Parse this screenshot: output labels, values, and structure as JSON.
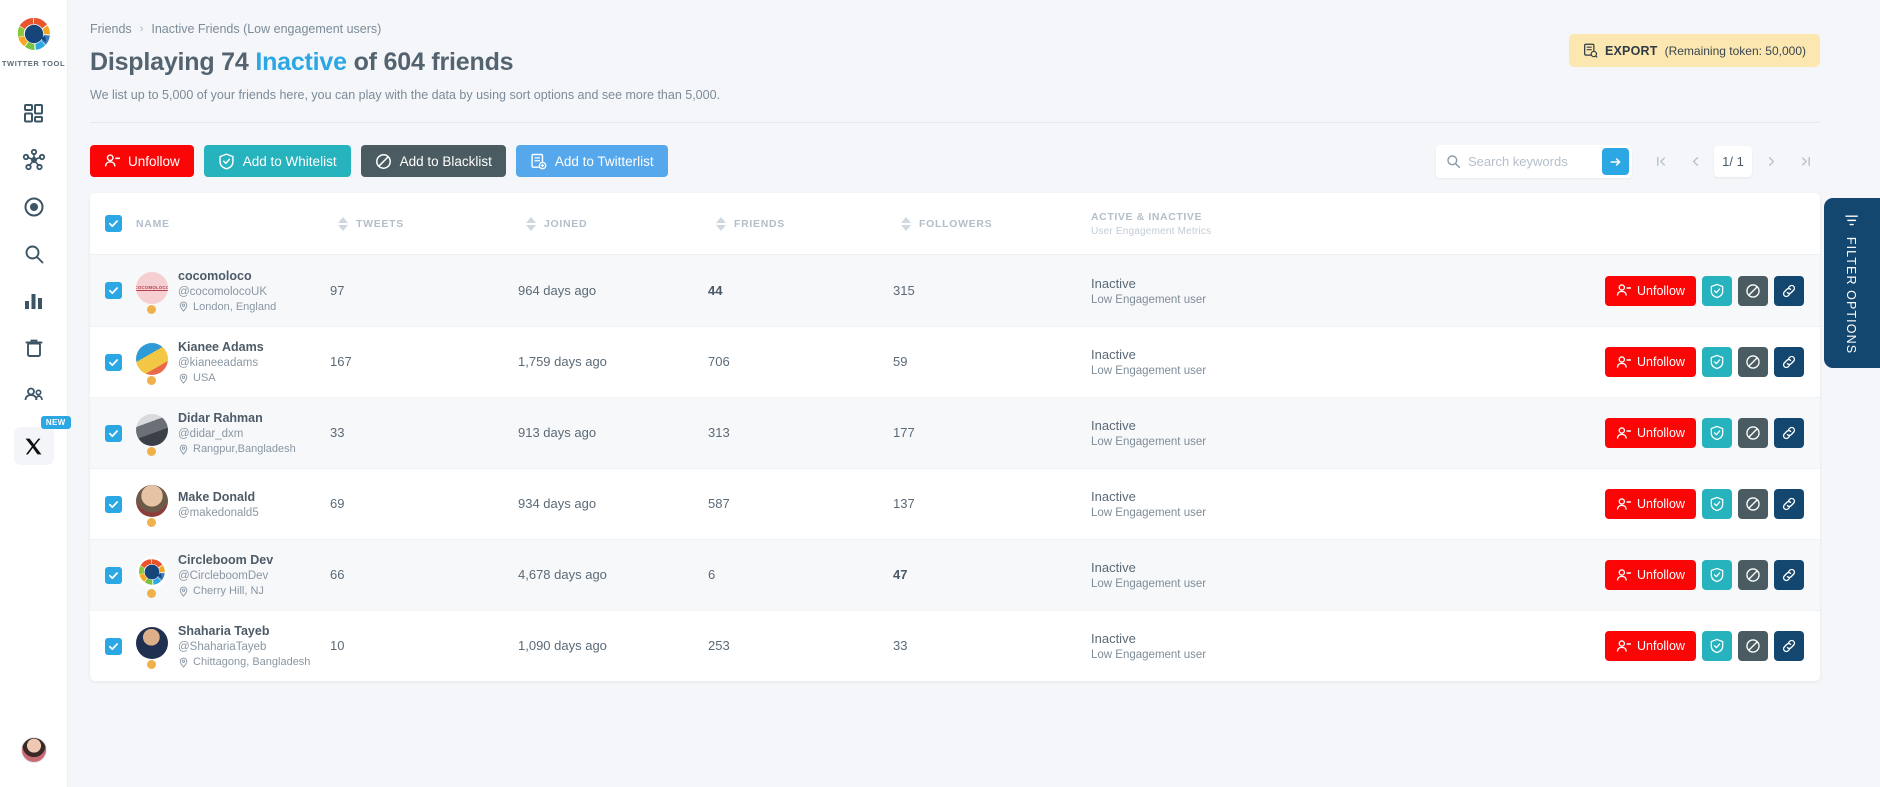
{
  "sidebar": {
    "brand_name": "TWITTER TOOL",
    "items": [
      {
        "name": "dashboard",
        "icon": "dashboard-icon"
      },
      {
        "name": "network",
        "icon": "network-icon"
      },
      {
        "name": "target",
        "icon": "target-icon"
      },
      {
        "name": "search",
        "icon": "search-icon"
      },
      {
        "name": "analytics",
        "icon": "bar-chart-icon"
      },
      {
        "name": "trash",
        "icon": "trash-icon"
      },
      {
        "name": "friends",
        "icon": "users-icon"
      },
      {
        "name": "x-twitter",
        "icon": "x-logo-icon",
        "badge": "NEW"
      }
    ]
  },
  "breadcrumb": {
    "root": "Friends",
    "separator": "›",
    "current": "Inactive Friends (Low engagement users)"
  },
  "header": {
    "title_pre": "Displaying 74 ",
    "title_highlight": "Inactive",
    "title_post": " of 604 friends",
    "subtitle": "We list up to 5,000 of your friends here, you can play with the data by using sort options and see more than 5,000."
  },
  "export": {
    "label": "EXPORT",
    "detail": "(Remaining token: 50,000)",
    "bg": "#fde7b0"
  },
  "toolbar": {
    "unfollow": "Unfollow",
    "whitelist": "Add to Whitelist",
    "blacklist": "Add to Blacklist",
    "twitterlist": "Add to Twitterlist",
    "colors": {
      "unfollow": "#fb0606",
      "whitelist": "#26b3be",
      "blacklist": "#4a5c61",
      "twitterlist": "#55a8ec"
    }
  },
  "search": {
    "placeholder": "Search keywords",
    "value": ""
  },
  "pagination": {
    "first": "❘◂",
    "prev": "‹",
    "current": "1/ 1",
    "next": "›",
    "last": "▸❘"
  },
  "table": {
    "columns": {
      "name": "NAME",
      "tweets": "TWEETS",
      "joined": "JOINED",
      "friends": "FRIENDS",
      "followers": "FOLLOWERS",
      "status_title": "ACTIVE & INACTIVE",
      "status_sub": "User Engagement Metrics"
    },
    "row_action_labels": {
      "unfollow": "Unfollow"
    },
    "rows": [
      {
        "name": "cocomoloco",
        "handle": "@cocomolocoUK",
        "location": "London, England",
        "tweets": "97",
        "joined": "964 days ago",
        "friends": "44",
        "followers": "315",
        "status": "Inactive",
        "status_sub": "Low Engagement user",
        "checked": true,
        "avatar_kind": "text",
        "avatar_text": "COCOMOLOCO",
        "avatar_bg": "#f5cfd2"
      },
      {
        "name": "Kianee Adams",
        "handle": "@kianeeadams",
        "location": "USA",
        "tweets": "167",
        "joined": "1,759 days ago",
        "friends": "706",
        "followers": "59",
        "status": "Inactive",
        "status_sub": "Low Engagement user",
        "checked": true,
        "avatar_kind": "art",
        "avatar_bg": "#2e9bd6"
      },
      {
        "name": "Didar Rahman",
        "handle": "@didar_dxm",
        "location": "Rangpur,Bangladesh",
        "tweets": "33",
        "joined": "913 days ago",
        "friends": "313",
        "followers": "177",
        "status": "Inactive",
        "status_sub": "Low Engagement user",
        "checked": true,
        "avatar_kind": "photo-dark",
        "avatar_bg": "#5b5f66"
      },
      {
        "name": "Make Donald",
        "handle": "@makedonald5",
        "location": "",
        "tweets": "69",
        "joined": "934 days ago",
        "friends": "587",
        "followers": "137",
        "status": "Inactive",
        "status_sub": "Low Engagement user",
        "checked": true,
        "avatar_kind": "photo-warm",
        "avatar_bg": "#7d6a58"
      },
      {
        "name": "Circleboom Dev",
        "handle": "@CircleboomDev",
        "location": "Cherry Hill, NJ",
        "tweets": "66",
        "joined": "4,678 days ago",
        "friends": "6",
        "followers": "47",
        "status": "Inactive",
        "status_sub": "Low Engagement user",
        "checked": true,
        "avatar_kind": "logo",
        "avatar_bg": "#ffffff"
      },
      {
        "name": "Shaharia Tayeb",
        "handle": "@ShahariaTayeb",
        "location": "Chittagong, Bangladesh",
        "tweets": "10",
        "joined": "1,090 days ago",
        "friends": "253",
        "followers": "33",
        "status": "Inactive",
        "status_sub": "Low Engagement user",
        "checked": true,
        "avatar_kind": "photo-blue",
        "avatar_bg": "#2c3e5c"
      }
    ]
  },
  "filter_tab": {
    "label": "FILTER OPTIONS",
    "bg": "#14476f"
  }
}
